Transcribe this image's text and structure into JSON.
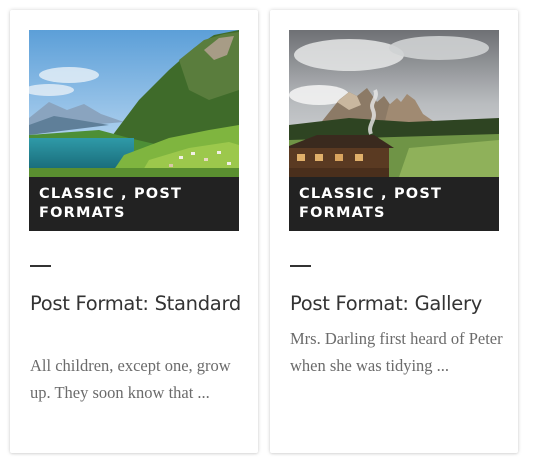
{
  "posts": [
    {
      "categories": "CLASSIC , POST FORMATS",
      "title": "Post Format: Standard",
      "excerpt": "All children, except one, grow up. They soon know that ..."
    },
    {
      "categories": "CLASSIC , POST FORMATS",
      "title": "Post Format: Gallery",
      "excerpt": "Mrs. Darling first heard of Peter when she was tidying ..."
    }
  ],
  "colors": {
    "category_band": "#222222",
    "title": "#333333",
    "excerpt": "#6b6b6b"
  }
}
